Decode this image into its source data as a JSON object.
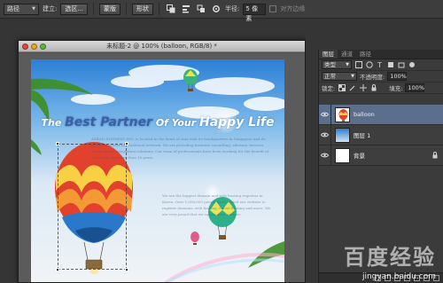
{
  "options_bar": {
    "mode_select": "路径",
    "make_label": "建立:",
    "selection_button": "选区...",
    "mask_button": "蒙版",
    "shape_button": "形状",
    "radius_label": "半径:",
    "radius_value": "5 像素",
    "align_edges_label": "对齐边缘"
  },
  "document": {
    "title": "未标题-2 @ 100% (balloon, RGB/8) *",
    "artwork": {
      "headline_the": "The",
      "headline_best": "Best Partner",
      "headline_of": "Of Your",
      "headline_happy": "Happy Life",
      "body_text_1": "ASEAN INTEREST INC. is located in the heart of Asia with its headquarters in Singapore and its presence across international network. We are providing business consulting, advisory services and business integration solutions. Our team of professionals have been working for the benefit of our clients for more than 10 years.",
      "body_text_2": "We are the biggest domain and web hosting registrar in Korea. Over 1,000,000 people have visited our website to register domains, web hosting, e-mail hosting and more. We are very proud that we can be your partner."
    }
  },
  "layers_panel": {
    "tabs": [
      "图层",
      "通道",
      "路径"
    ],
    "kind_filter": "类型",
    "blend_mode": "正常",
    "opacity_label": "不透明度:",
    "opacity_value": "100%",
    "lock_label": "锁定:",
    "fill_label": "填充:",
    "fill_value": "100%",
    "layers": [
      {
        "name": "balloon",
        "selected": true,
        "locked": false
      },
      {
        "name": "图层 1",
        "selected": false,
        "locked": false
      },
      {
        "name": "背景",
        "selected": false,
        "locked": true
      }
    ]
  },
  "watermark": {
    "text": "百度经验",
    "url": "jingyan.baidu.com"
  },
  "colors": {
    "app_bg": "#353535",
    "panel_bg": "#3b3b3b",
    "selected_layer": "#5b6f8c",
    "sky_top": "#2b7fd6",
    "headline_blue": "#3d5fa8"
  }
}
